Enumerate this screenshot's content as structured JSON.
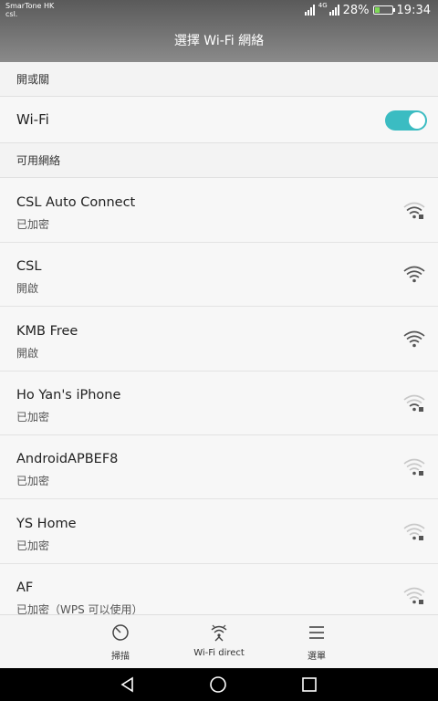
{
  "status": {
    "carrier_line1": "SmarTone HK",
    "carrier_line2": "csl.",
    "network_type": "4G",
    "battery": "28%",
    "battery_level": 0.28,
    "time": "19:34"
  },
  "header": {
    "title": "選擇 Wi-Fi 網絡"
  },
  "sections": {
    "onoff": "開或關",
    "available": "可用網絡"
  },
  "wifi": {
    "label": "Wi-Fi",
    "enabled": true,
    "accent": "#3bbcc2"
  },
  "networks": [
    {
      "name": "CSL Auto Connect",
      "status": "已加密",
      "signal": 3,
      "secured": true
    },
    {
      "name": "CSL",
      "status": "開啟",
      "signal": 4,
      "secured": false
    },
    {
      "name": "KMB Free",
      "status": "開啟",
      "signal": 4,
      "secured": false
    },
    {
      "name": "Ho Yan's iPhone",
      "status": "已加密",
      "signal": 2,
      "secured": true
    },
    {
      "name": "AndroidAPBEF8",
      "status": "已加密",
      "signal": 1,
      "secured": true
    },
    {
      "name": "YS Home",
      "status": "已加密",
      "signal": 1,
      "secured": true
    },
    {
      "name": "AF",
      "status": "已加密（WPS 可以使用）",
      "signal": 1,
      "secured": true
    }
  ],
  "toolbar": {
    "scan": {
      "label": "掃描",
      "icon": "scan-icon"
    },
    "direct": {
      "label": "Wi-Fi direct",
      "icon": "wifi-direct-icon"
    },
    "menu": {
      "label": "選單",
      "icon": "menu-icon"
    }
  },
  "navbar": {
    "back_icon": "back-icon",
    "home_icon": "home-icon",
    "recents_icon": "recents-icon"
  }
}
